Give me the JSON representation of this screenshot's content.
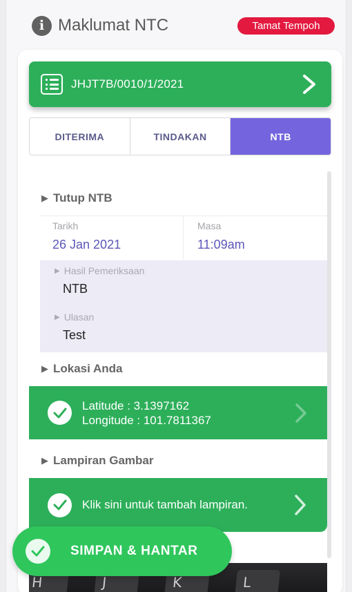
{
  "header": {
    "title": "Maklumat NTC",
    "status_badge": "Tamat Tempoh"
  },
  "reference": {
    "number": "JHJT7B/0010/1/2021"
  },
  "tabs": [
    {
      "label": "DITERIMA",
      "active": false
    },
    {
      "label": "TINDAKAN",
      "active": false
    },
    {
      "label": "NTB",
      "active": true
    }
  ],
  "tutup_ntb": {
    "title": "Tutup NTB",
    "date_label": "Tarikh",
    "date_value": "26 Jan 2021",
    "time_label": "Masa",
    "time_value": "11:09am",
    "result_label": "Hasil Pemeriksaan",
    "result_value": "NTB",
    "remarks_label": "Ulasan",
    "remarks_value": "Test"
  },
  "location": {
    "title": "Lokasi Anda",
    "latitude": "Latitude : 3.1397162",
    "longitude": "Longitude : 101.7811367"
  },
  "attachments": {
    "title": "Lampiran Gambar",
    "add_text": "Klik sini untuk tambah lampiran."
  },
  "photo_keys": [
    "H",
    "J",
    "K",
    "L"
  ],
  "submit": {
    "label": "SIMPAN & HANTAR"
  },
  "colors": {
    "green": "#2daf5a",
    "fab_green": "#2fc65c",
    "tab_active": "#7465de",
    "badge_red": "#e3193f",
    "date_purple": "#5c56b8"
  }
}
